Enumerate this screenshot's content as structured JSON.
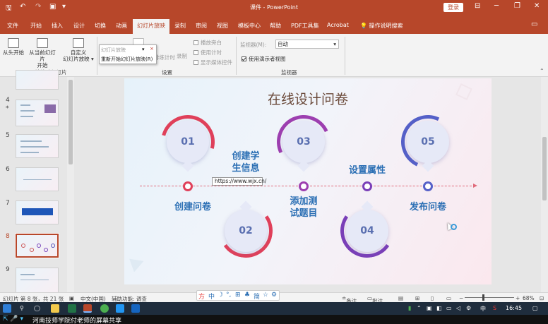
{
  "window": {
    "title": "课件 - PowerPoint",
    "login": "登录",
    "minimize": "─",
    "restore": "❐",
    "close": "✕",
    "ribbon_opts": "⊟"
  },
  "qat": {
    "save": "🖫",
    "undo": "↶",
    "redo": "↷",
    "start": "▣",
    "more": "▾"
  },
  "tabs": [
    "文件",
    "开始",
    "插入",
    "设计",
    "切换",
    "动画",
    "幻灯片放映",
    "录制",
    "审阅",
    "视图",
    "模板中心",
    "帮助",
    "PDF工具集",
    "Acrobat"
  ],
  "active_tab": "幻灯片放映",
  "tell_me": "操作说明搜索",
  "ribbon": {
    "from_start": "从头开始",
    "from_current_1": "从当前幻灯片",
    "from_current_2": "开始",
    "custom_1": "自定义",
    "custom_2": "幻灯片放映 ▾",
    "group_start": "开始放映幻灯片",
    "rehearse_partial": "排练计时",
    "record_partial": "录制",
    "play_narration": "播放旁白",
    "use_timing": "使用计时",
    "show_controls": "显示媒体控件",
    "group_setup": "设置",
    "monitor_label": "监视器(M):",
    "monitor_value": "自动",
    "presenter_view": "使用演示者视图",
    "group_monitor": "监视器",
    "dropdown_top": "幻灯片放映",
    "dropdown_item": "重新开始幻灯片放映(R)"
  },
  "thumbnails": [
    {
      "num": "4",
      "star": "*"
    },
    {
      "num": "5"
    },
    {
      "num": "6"
    },
    {
      "num": "7"
    },
    {
      "num": "8"
    },
    {
      "num": "9"
    }
  ],
  "slide": {
    "title": "在线设计问卷",
    "steps": [
      {
        "num": "01",
        "label": "创建问卷"
      },
      {
        "num": "02",
        "label1": "创建学",
        "label2": "生信息"
      },
      {
        "num": "03",
        "label1": "添加测",
        "label2": "试题目"
      },
      {
        "num": "04",
        "label": "设置属性"
      },
      {
        "num": "05",
        "label": "发布问卷"
      }
    ],
    "url_tooltip": "https://www.wjx.cn/"
  },
  "status": {
    "slide_info": "幻灯片 第 8 张，共 21 张",
    "language": "中文(中国)",
    "accessibility": "辅助功能: 调查",
    "notes": "备注",
    "comments": "批注",
    "zoom": "68%"
  },
  "ime": [
    "方",
    "中",
    "☽",
    "°,",
    "⊞",
    "♣",
    "简",
    "☆",
    "⚙"
  ],
  "taskbar": {
    "time": "16:45",
    "ime_cn": "中",
    "ime_s": "S"
  },
  "share_banner": "河南技师学院付老师的屏幕共享"
}
